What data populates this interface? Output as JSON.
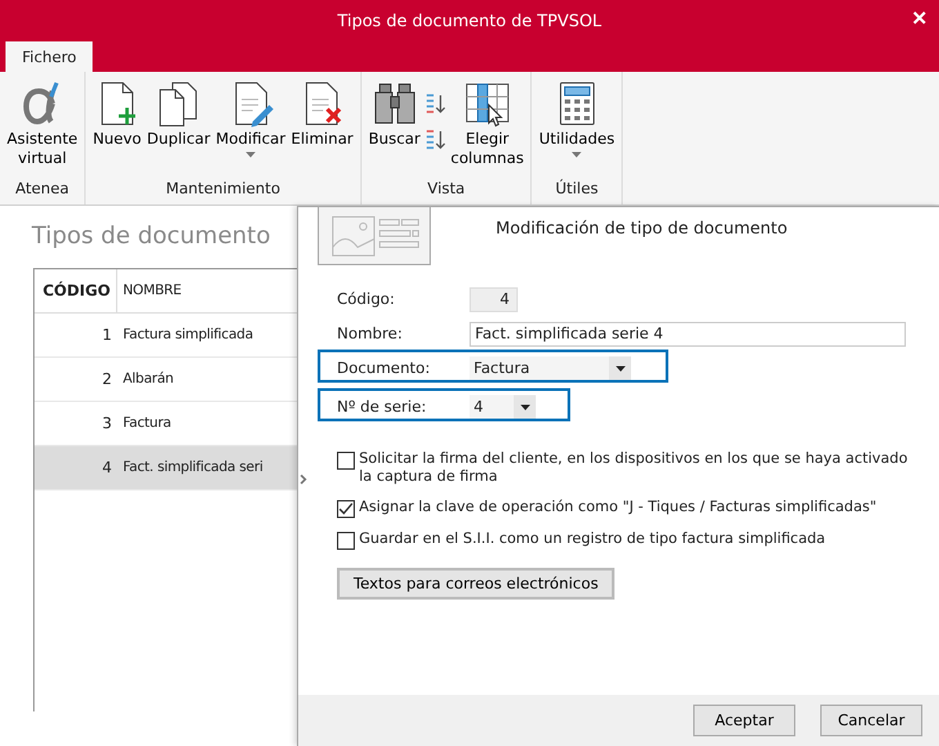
{
  "window": {
    "title": "Tipos de documento de TPVSOL",
    "close": "✕"
  },
  "tabs": [
    {
      "label": "Fichero",
      "selected": true
    }
  ],
  "ribbon": [
    {
      "label": "Atenea",
      "buttons": [
        {
          "kind": "large",
          "label": "Asistente virtual"
        }
      ]
    },
    {
      "label": "Mantenimiento",
      "buttons": [
        {
          "kind": "large",
          "label": "Nuevo"
        },
        {
          "kind": "large",
          "label": "Duplicar"
        },
        {
          "kind": "large",
          "label": "Modificar",
          "dropdown": true
        },
        {
          "kind": "large",
          "label": "Eliminar"
        }
      ]
    },
    {
      "label": "Vista",
      "buttons": [
        {
          "kind": "large",
          "label": "Buscar"
        },
        {
          "kind": "small"
        },
        {
          "kind": "large",
          "label": "Elegir columnas"
        }
      ]
    },
    {
      "label": "Útiles",
      "buttons": [
        {
          "kind": "large",
          "label": "Utilidades",
          "dropdown": true
        }
      ]
    }
  ],
  "page": {
    "heading": "Tipos de documento"
  },
  "table": {
    "columns": [
      "CÓDIGO",
      "NOMBRE"
    ],
    "rows": [
      {
        "code": "1",
        "name": "Factura simplificada",
        "selected": false
      },
      {
        "code": "2",
        "name": "Albarán",
        "selected": false
      },
      {
        "code": "3",
        "name": "Factura",
        "selected": false
      },
      {
        "code": "4",
        "name": "Fact. simplificada seri",
        "selected": true
      }
    ]
  },
  "panel": {
    "title": "Modificación de tipo de documento",
    "fields": [
      {
        "kind": "readonly",
        "label": "Código:",
        "value": "4"
      },
      {
        "kind": "text",
        "label": "Nombre:",
        "value": "Fact. simplificada serie 4"
      },
      {
        "kind": "select",
        "label": "Documento:",
        "value": "Factura",
        "highlighted": true
      },
      {
        "kind": "select-short",
        "label": "Nº de serie:",
        "value": "4",
        "highlighted": true
      }
    ],
    "checkboxes": [
      {
        "label": "Solicitar la firma del cliente, en los dispositivos en los que se haya activado la captura de firma",
        "checked": false
      },
      {
        "label": "Asignar la clave de operación como \"J - Tiques / Facturas simplificadas\"",
        "checked": true
      },
      {
        "label": "Guardar en el S.I.I. como un registro de tipo factura simplificada",
        "checked": false
      }
    ],
    "action": "Textos para correos electrónicos",
    "buttons": [
      "Aceptar",
      "Cancelar"
    ]
  }
}
